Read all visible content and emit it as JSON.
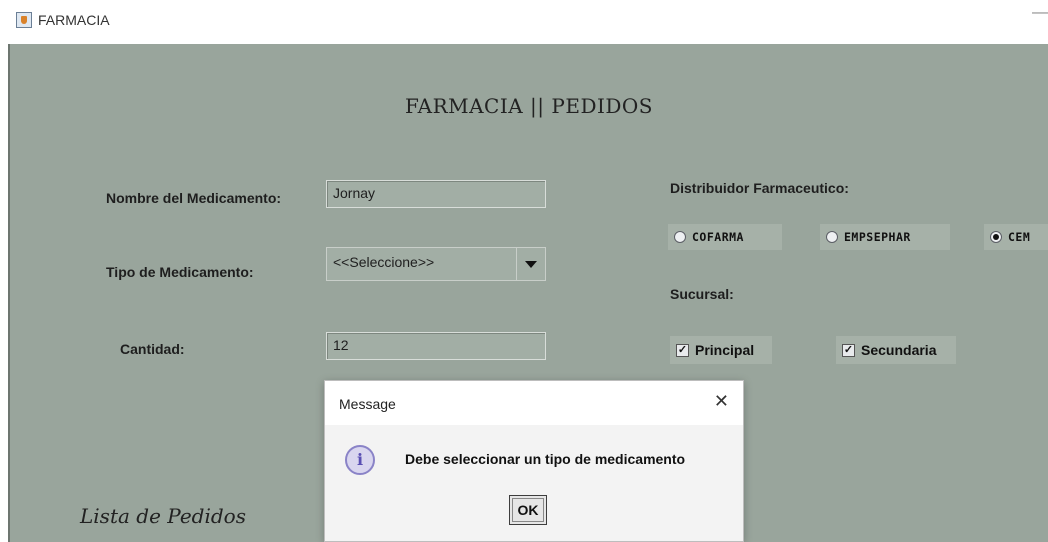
{
  "window": {
    "title": "FARMACIA",
    "minimize_label": "—"
  },
  "form": {
    "header": "FARMACIA || PEDIDOS",
    "nombre_label": "Nombre del Medicamento:",
    "nombre_value": "Jornay",
    "tipo_label": "Tipo de Medicamento:",
    "tipo_value": "<<Seleccione>>",
    "cantidad_label": "Cantidad:",
    "cantidad_value": "12",
    "distribuidor_label": "Distribuidor Farmaceutico:",
    "distribuidores": [
      {
        "label": "COFARMA",
        "selected": false
      },
      {
        "label": "EMPSEPHAR",
        "selected": false
      },
      {
        "label": "CEM",
        "selected": true
      }
    ],
    "sucursal_label": "Sucursal:",
    "sucursales": [
      {
        "label": "Principal",
        "checked": true
      },
      {
        "label": "Secundaria",
        "checked": true
      }
    ],
    "lista_label": "Lista de Pedidos"
  },
  "dialog": {
    "title": "Message",
    "close_label": "✕",
    "icon_glyph": "i",
    "message": "Debe seleccionar un tipo de medicamento",
    "ok_label": "OK"
  },
  "colors": {
    "panel": "#99a59c",
    "field": "#a2aea5"
  }
}
